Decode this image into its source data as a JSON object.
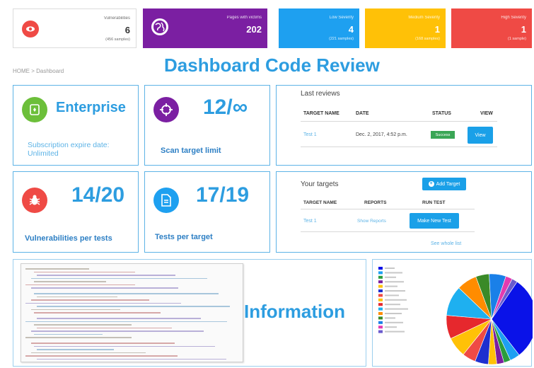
{
  "stats": [
    {
      "title": "Vulnerabilities",
      "value": "6",
      "sub": "(456 samples)",
      "color": "#ffffff",
      "icon": "eye-icon"
    },
    {
      "title": "Pages with victims",
      "value": "202",
      "sub": "",
      "color": "#7b1fa2",
      "icon": "globe-icon"
    },
    {
      "title": "Low Severity",
      "value": "4",
      "sub": "(221 samples)",
      "color": "#1ea0f0"
    },
    {
      "title": "Medium Severity",
      "value": "1",
      "sub": "(168 samples)",
      "color": "#ffc107"
    },
    {
      "title": "High Severity",
      "value": "1",
      "sub": "(1 sample)",
      "color": "#ef4a45"
    }
  ],
  "breadcrumb": "HOME > Dashboard",
  "page_title": "Dashboard Code Review",
  "cards": {
    "plan": {
      "title": "Enterprise",
      "caption": "Subscription expire date: Unlimited",
      "icon": "license-icon",
      "color": "#6cbf3a"
    },
    "scan": {
      "value": "12/∞",
      "caption": "Scan target limit",
      "icon": "crosshair-icon",
      "color": "#7b1fa2"
    },
    "vuln": {
      "value": "14/20",
      "caption": "Vulnerabilities per tests",
      "icon": "bug-icon",
      "color": "#ef4a45"
    },
    "tests": {
      "value": "17/19",
      "caption": "Tests per target",
      "icon": "document-icon",
      "color": "#1ea0f0"
    }
  },
  "last_reviews": {
    "title": "Last reviews",
    "columns": [
      "TARGET NAME",
      "DATE",
      "STATUS",
      "VIEW"
    ],
    "rows": [
      {
        "target": "Test 1",
        "date": "Dec. 2, 2017, 4:52 p.m.",
        "status": "Success",
        "action": "View"
      }
    ]
  },
  "your_targets": {
    "title": "Your targets",
    "add_label": "Add Target",
    "columns": [
      "TARGET NAME",
      "REPORTS",
      "RUN TEST"
    ],
    "rows": [
      {
        "target": "Test 1",
        "reports": "Show Reports",
        "action": "Make New Test"
      }
    ],
    "see_all": "See whole list"
  },
  "information": {
    "label": "Information"
  },
  "chart_data": {
    "type": "pie",
    "categories": [
      "c1",
      "c2",
      "c3",
      "c4",
      "c5",
      "c6",
      "c7",
      "c8",
      "c9",
      "c10",
      "c11",
      "c12",
      "c13",
      "c14",
      "c15"
    ],
    "values": [
      30.0,
      3.6,
      2.4,
      2.6,
      3.0,
      4.8,
      4.8,
      7.2,
      8.4,
      10.8,
      7.2,
      4.8,
      6.0,
      2.4,
      2.0
    ],
    "colors": [
      "#0a12e8",
      "#1da0f2",
      "#2a9d3d",
      "#7a1fa0",
      "#ffc107",
      "#1e2fd0",
      "#ef4a45",
      "#ffc107",
      "#e6282d",
      "#1eb0f0",
      "#ff8c00",
      "#3a8a28",
      "#1a80e8",
      "#e23bb0",
      "#6a5acd"
    ],
    "legend_position": "top-left"
  }
}
